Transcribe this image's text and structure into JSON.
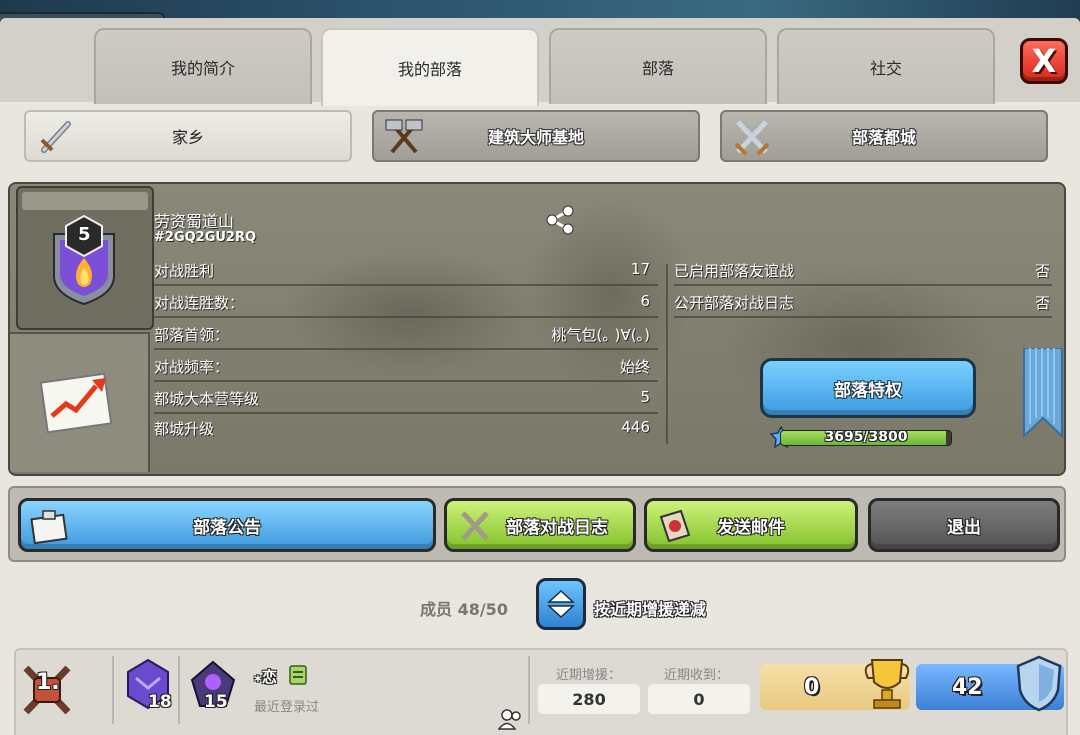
{
  "tabs": [
    {
      "label": "我的简介"
    },
    {
      "label": "我的部落"
    },
    {
      "label": "部落"
    },
    {
      "label": "社交"
    }
  ],
  "close_label": "X",
  "subtabs": [
    {
      "label": "家乡"
    },
    {
      "label": "建筑大师基地"
    },
    {
      "label": "部落都城"
    }
  ],
  "clan": {
    "name": "劳资蜀道山",
    "tag": "#2GQ2GU2RQ",
    "badge_level": "5",
    "stats_left": [
      {
        "label": "对战胜利",
        "value": "17"
      },
      {
        "label": "对战连胜数：",
        "value": "6"
      },
      {
        "label": "部落首领：",
        "value": "桃气包(｡ )∀(｡)"
      },
      {
        "label": "对战频率：",
        "value": "始终"
      },
      {
        "label": "都城大本营等级",
        "value": "5"
      },
      {
        "label": "都城升级",
        "value": "446"
      }
    ],
    "stats_right": [
      {
        "label": "已启用部落友谊战",
        "value": "否"
      },
      {
        "label": "公开部落对战日志",
        "value": "否"
      }
    ],
    "perks_label": "部落特权",
    "xp_text": "3695/3800",
    "xp_progress": 0.97
  },
  "actions": {
    "announcement": "部落公告",
    "war_log": "部落对战日志",
    "send_mail": "发送邮件",
    "leave": "退出"
  },
  "members": {
    "count_label": "成员 48/50",
    "sort_label": "按近期增援递减"
  },
  "member_row": {
    "rank": "1.",
    "exp_level": "18",
    "town_hall_level": "15",
    "name": "⁎恋",
    "role": "最近登录过",
    "donations_label": "近期增援：",
    "donations_value": "280",
    "received_label": "近期收到：",
    "received_value": "0",
    "trophies": "0",
    "league_value": "42"
  },
  "colors": {
    "panel": "#e8e6df",
    "close": "#d8261a",
    "blue_button": "#3d98dc",
    "green_button": "#82c22c",
    "gray_button": "#525252"
  }
}
